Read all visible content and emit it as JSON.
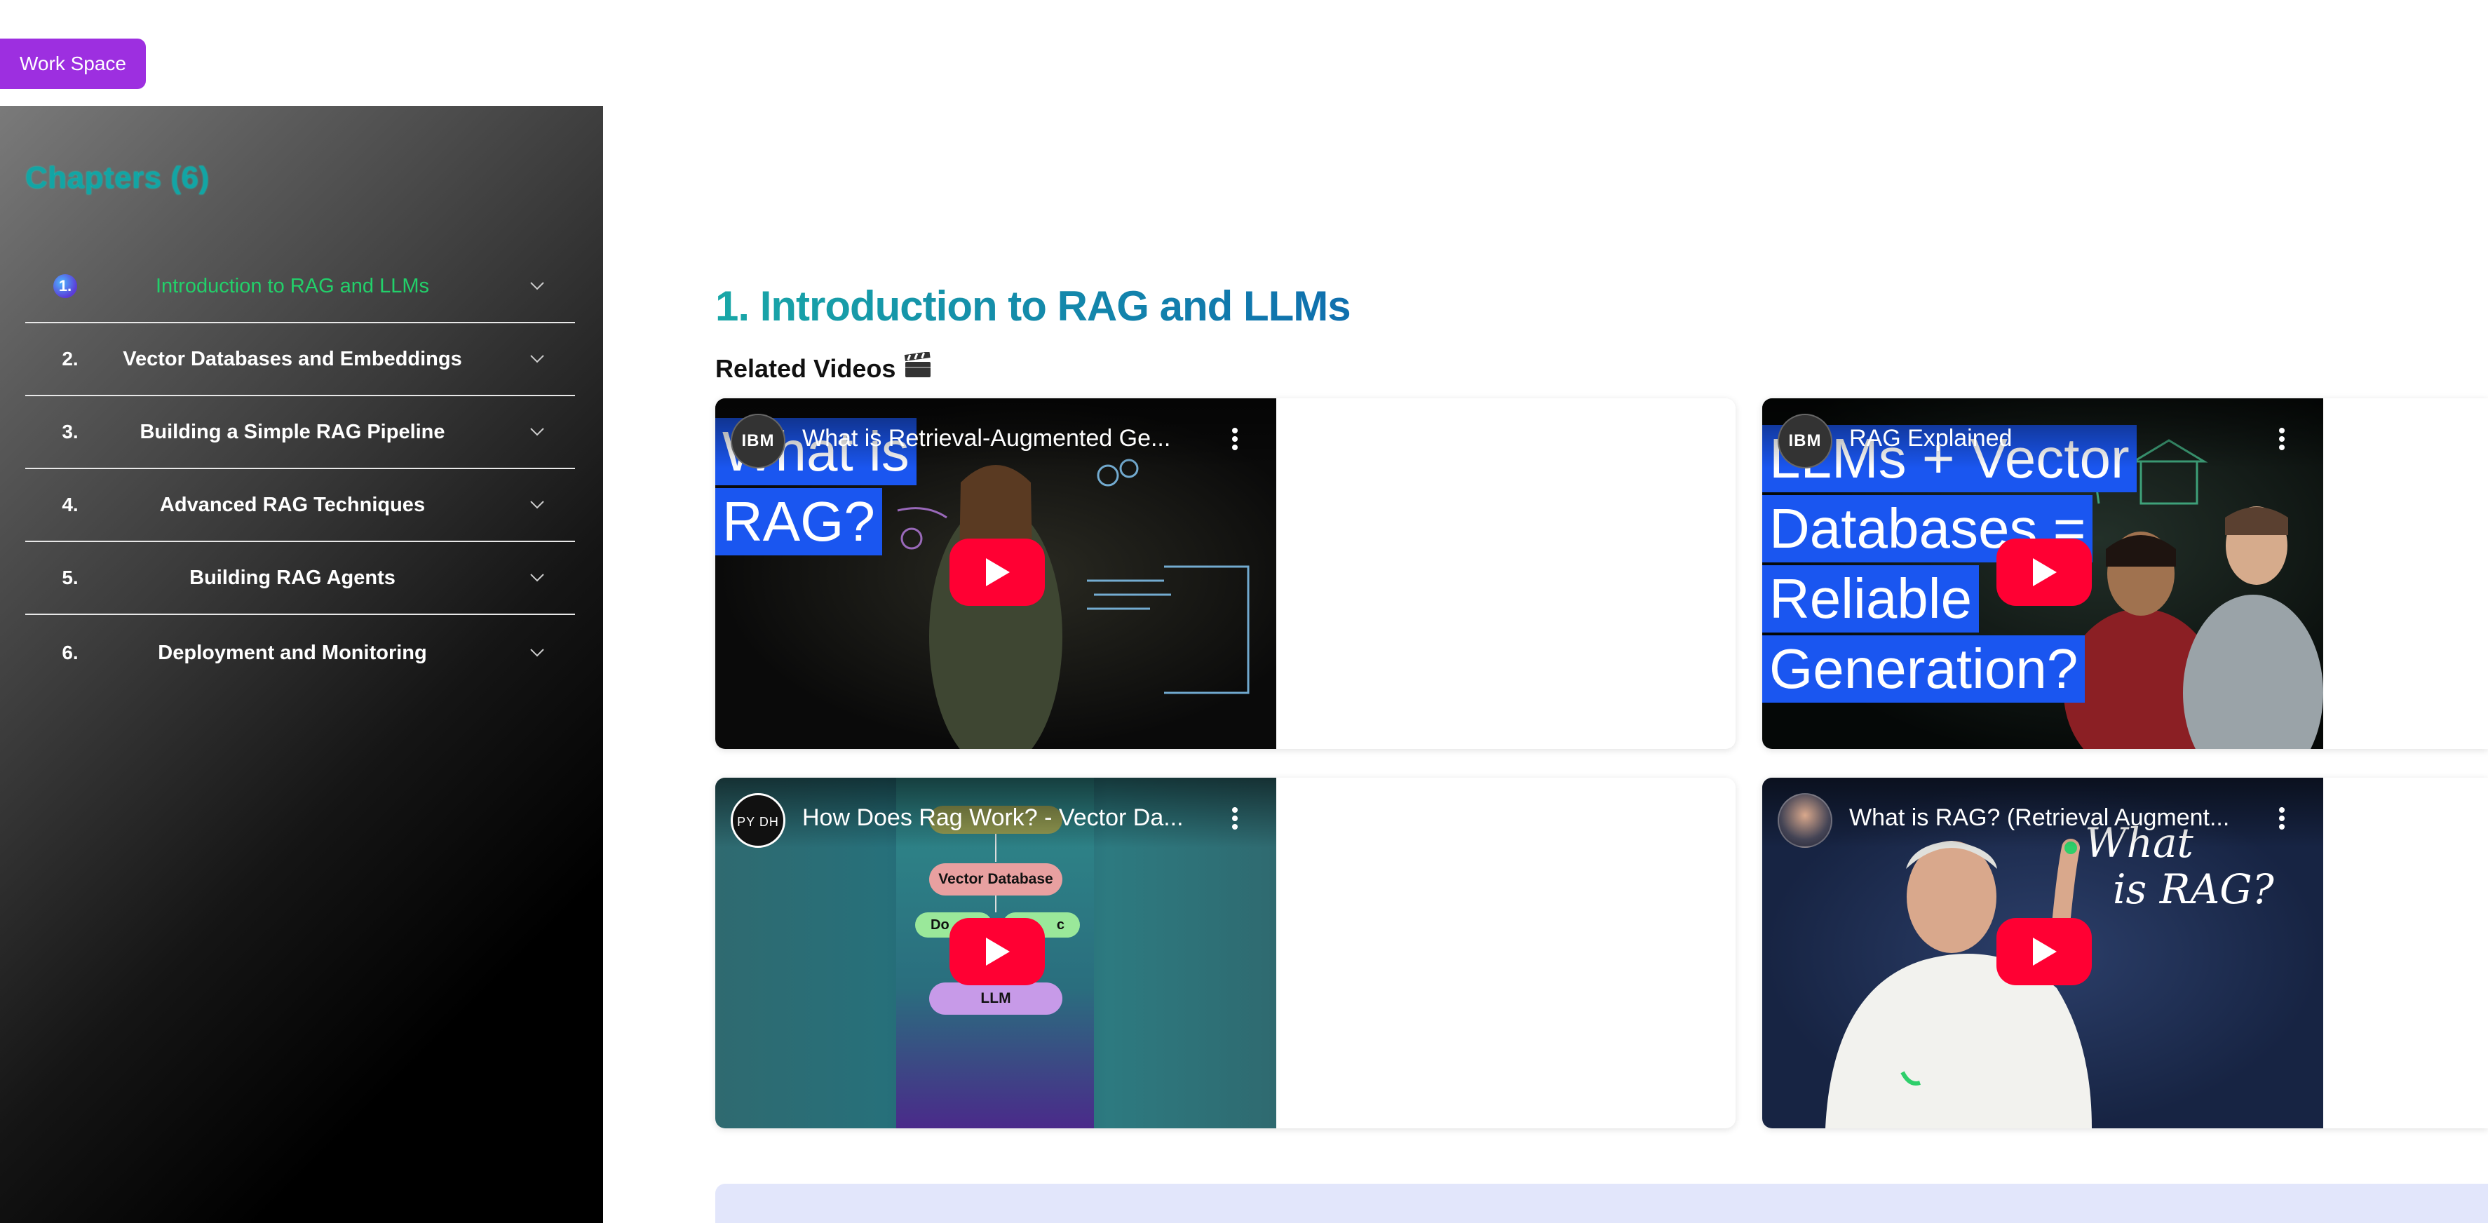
{
  "workspace_button": "Work Space",
  "sidebar": {
    "title": "Chapters (6)",
    "chapters": [
      {
        "num": "1.",
        "label": "Introduction to RAG and LLMs",
        "active": true
      },
      {
        "num": "2.",
        "label": "Vector Databases and Embeddings"
      },
      {
        "num": "3.",
        "label": "Building a Simple RAG Pipeline"
      },
      {
        "num": "4.",
        "label": "Advanced RAG Techniques"
      },
      {
        "num": "5.",
        "label": "Building RAG Agents"
      },
      {
        "num": "6.",
        "label": "Deployment and Monitoring"
      }
    ],
    "chevron_icon": "chevron-down-icon"
  },
  "main": {
    "title": "1. Introduction to RAG and LLMs",
    "related_heading": "Related Videos",
    "related_icon": "clapperboard-icon",
    "videos": [
      {
        "channel": "IBM",
        "title": "What is Retrieval-Augmented Ge...",
        "overlay_lines": [
          "What is",
          "RAG?"
        ]
      },
      {
        "channel": "IBM",
        "title": "RAG Explained",
        "overlay_lines": [
          "LLMs + Vector",
          "Databases =",
          "Reliable",
          "Generation?"
        ]
      },
      {
        "channel": "PY DH",
        "title": "How Does Rag Work? - Vector Da...",
        "diagram": {
          "vector_db": "Vector Database",
          "doc_left": "Do",
          "doc_right": "c",
          "llm": "LLM"
        }
      },
      {
        "channel": "",
        "title": "What is RAG? (Retrieval Augment...",
        "overlay_lines": [
          "What",
          "is RAG?"
        ]
      }
    ]
  },
  "colors": {
    "workspace_purple": "#9d2fe0",
    "chapters_teal": "#12a5a5",
    "active_green": "#22d06a",
    "youtube_red": "#ff0033"
  }
}
